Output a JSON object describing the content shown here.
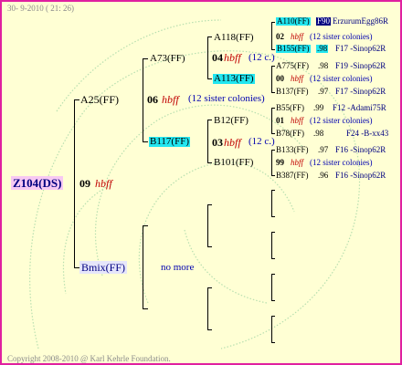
{
  "header": {
    "timestamp": "30-  9-2010 ( 21: 26)"
  },
  "footer": {
    "copyright": "Copyright 2008-2010 @ Karl Kehrle Foundation."
  },
  "root": {
    "id": "Z104(DS)",
    "year": "09",
    "note": "hbff"
  },
  "gen1": {
    "top": {
      "id": "A25(FF)",
      "year": "06",
      "note": "hbff",
      "colonies": "(12 sister colonies)"
    },
    "bottom": {
      "id": "Bmix(FF)",
      "note": "no more"
    }
  },
  "gen2": {
    "a73": {
      "id": "A73(FF)",
      "year": "04",
      "note": "hbff",
      "colonies": "(12 c.)"
    },
    "b117": {
      "id": "B117(FF)",
      "year": "03",
      "note": "hbff",
      "colonies": "(12 c.)"
    }
  },
  "gen3": {
    "a118": {
      "id": "A118(FF)",
      "year": "02",
      "note": "hbff",
      "colonies": "(12 sister colonies)"
    },
    "a113": {
      "id": "A113(FF)",
      "year": "00",
      "note": "hbff",
      "colonies": "(12 sister colonies)"
    },
    "b12": {
      "id": "B12(FF)",
      "year": "01",
      "note": "hbff",
      "colonies": "(12 sister colonies)"
    },
    "b101": {
      "id": "B101(FF)",
      "year": "99",
      "note": "hbff",
      "colonies": "(12 sister colonies)"
    }
  },
  "gen4": {
    "a110": {
      "id": "A110(FF)",
      "year": "F90",
      "origin": "ErzurumEgg86R"
    },
    "b155": {
      "id": "B155(FF)",
      "year": ".98",
      "origin": "F17 -Sinop62R"
    },
    "a775": {
      "id": "A775(FF)",
      "year": ".98",
      "origin": "F19 -Sinop62R"
    },
    "b137": {
      "id": "B137(FF)",
      "year": ".97",
      "origin": "F17 -Sinop62R"
    },
    "b55": {
      "id": "B55(FF)",
      "year": ".99",
      "origin": "F12 -Adami75R"
    },
    "b78": {
      "id": "B78(FF)",
      "year": ".98",
      "origin": "F24 -B-xx43"
    },
    "b133": {
      "id": "B133(FF)",
      "year": ".97",
      "origin": "F16 -Sinop62R"
    },
    "b387": {
      "id": "B387(FF)",
      "year": ".96",
      "origin": "F16 -Sinop62R"
    }
  }
}
